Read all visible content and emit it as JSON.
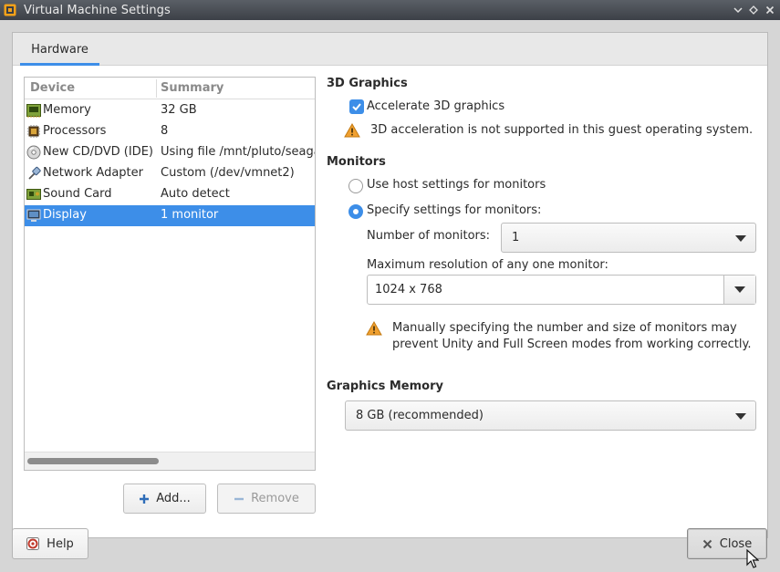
{
  "window": {
    "title": "Virtual Machine Settings"
  },
  "tabs": [
    {
      "label": "Hardware"
    }
  ],
  "device_table": {
    "headers": {
      "device": "Device",
      "summary": "Summary"
    },
    "rows": [
      {
        "device": "Memory",
        "summary": "32 GB",
        "icon": "memory-icon"
      },
      {
        "device": "Processors",
        "summary": "8",
        "icon": "processor-icon"
      },
      {
        "device": "New CD/DVD (IDE)",
        "summary": "Using file /mnt/pluto/seagate",
        "icon": "cd-dvd-icon"
      },
      {
        "device": "Network Adapter",
        "summary": "Custom (/dev/vmnet2)",
        "icon": "network-adapter-icon"
      },
      {
        "device": "Sound Card",
        "summary": "Auto detect",
        "icon": "sound-card-icon"
      },
      {
        "device": "Display",
        "summary": "1 monitor",
        "icon": "display-icon",
        "selected": true
      }
    ]
  },
  "device_buttons": {
    "add": "Add...",
    "remove": "Remove"
  },
  "graphics3d": {
    "title": "3D Graphics",
    "accelerate_label": "Accelerate 3D graphics",
    "accelerate_checked": true,
    "warning": "3D acceleration is not supported in this guest operating system."
  },
  "monitors": {
    "title": "Monitors",
    "option_host": "Use host settings for monitors",
    "option_specify": "Specify settings for monitors:",
    "selected_option": "specify",
    "num_label": "Number of monitors:",
    "num_value": "1",
    "res_label": "Maximum resolution of any one monitor:",
    "res_value": "1024 x 768",
    "warning_line1": "Manually specifying the number and size of monitors may",
    "warning_line2": "prevent Unity and Full Screen modes from working correctly."
  },
  "graphics_memory": {
    "title": "Graphics Memory",
    "value": "8 GB (recommended)"
  },
  "footer": {
    "help": "Help",
    "close": "Close"
  },
  "colors": {
    "accent": "#3d8ee8",
    "warning": "#f0a030"
  }
}
